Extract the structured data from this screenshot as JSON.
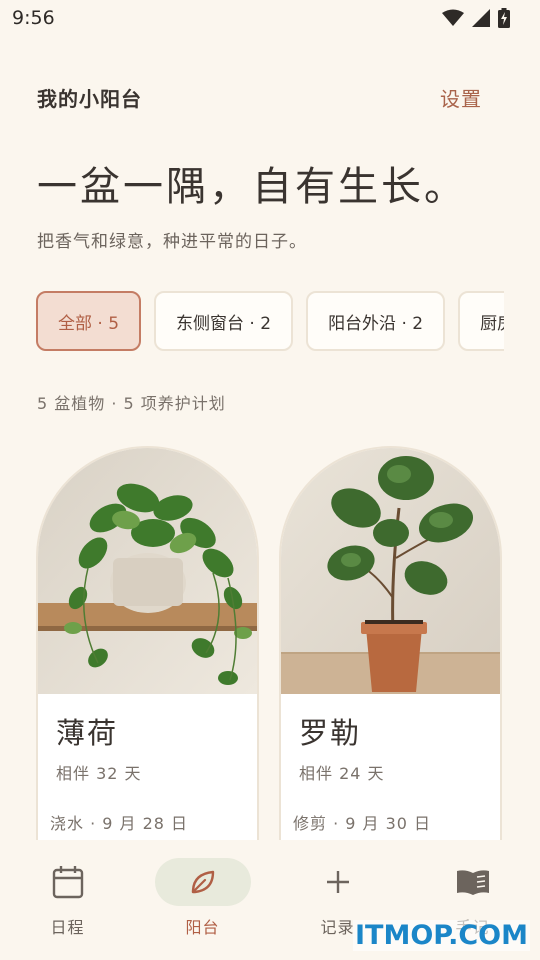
{
  "status": {
    "time": "9:56",
    "icons": [
      "wifi-icon",
      "cell-signal-icon",
      "battery-charging-icon"
    ]
  },
  "header": {
    "title": "我的小阳台",
    "settings_label": "设置"
  },
  "hero": {
    "title": "一盆一隅，自有生长。",
    "subtitle": "把香气和绿意，种进平常的日子。"
  },
  "filters": [
    {
      "label": "全部 · 5",
      "active": true
    },
    {
      "label": "东侧窗台 · 2",
      "active": false
    },
    {
      "label": "阳台外沿 · 2",
      "active": false
    },
    {
      "label": "厨房",
      "active": false
    }
  ],
  "summary": "5 盆植物 · 5 项养护计划",
  "plants": [
    {
      "name": "薄荷",
      "days": "相伴 32 天",
      "care": "浇水 · 9 月 28 日",
      "image": "pothos-on-shelf"
    },
    {
      "name": "罗勒",
      "days": "相伴 24 天",
      "care": "修剪 · 9 月 30 日",
      "image": "fiddle-leaf-fig-in-terracotta-pot"
    }
  ],
  "nav": [
    {
      "label": "日程",
      "icon": "calendar-icon",
      "active": false
    },
    {
      "label": "阳台",
      "icon": "leaf-icon",
      "active": true
    },
    {
      "label": "记录",
      "icon": "plus-icon",
      "active": false
    },
    {
      "label": "手记",
      "icon": "book-icon",
      "active": false
    }
  ],
  "watermark": "ITMOP.COM",
  "colors": {
    "background": "#fbf6ee",
    "accent": "#b05f45",
    "active_chip_bg": "#f3ddd2",
    "active_nav_pill": "#e8eadc",
    "watermark": "#1b86c8"
  }
}
